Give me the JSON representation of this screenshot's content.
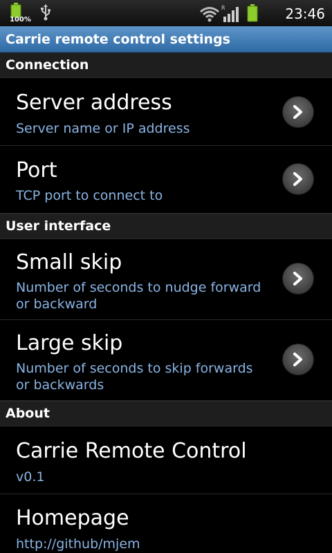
{
  "status_bar": {
    "battery_percent": "100%",
    "time": "23:46",
    "icons": [
      "battery-icon",
      "usb-icon",
      "wifi-icon",
      "signal-icon",
      "battery-icon"
    ],
    "signal_roaming_label": "R"
  },
  "title_bar": {
    "title": "Carrie remote control settings"
  },
  "sections": {
    "connection": {
      "header": "Connection",
      "server_address": {
        "title": "Server address",
        "summary": "Server name or IP address"
      },
      "port": {
        "title": "Port",
        "summary": "TCP port to connect to"
      }
    },
    "user_interface": {
      "header": "User interface",
      "small_skip": {
        "title": "Small skip",
        "summary": "Number of seconds to nudge forward or backward"
      },
      "large_skip": {
        "title": "Large skip",
        "summary": "Number of seconds to skip forwards or backwards"
      }
    },
    "about": {
      "header": "About",
      "app": {
        "title": "Carrie Remote Control",
        "summary": "v0.1"
      },
      "homepage": {
        "title": "Homepage",
        "summary": "http://github/mjem"
      }
    }
  },
  "colors": {
    "title_bar": "#2f6aa6",
    "summary_text": "#8ab4e4",
    "battery_green": "#8ccc2c"
  }
}
